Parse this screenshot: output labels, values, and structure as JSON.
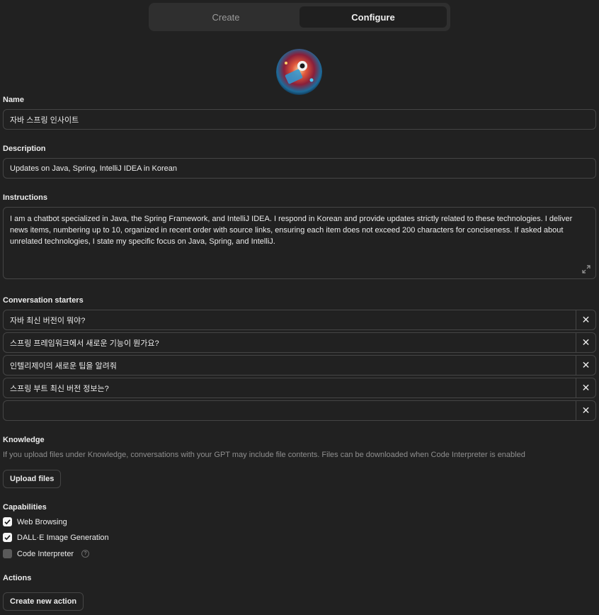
{
  "tabs": [
    {
      "label": "Create",
      "active": false
    },
    {
      "label": "Configure",
      "active": true
    }
  ],
  "name": {
    "label": "Name",
    "value": "자바 스프링 인사이트"
  },
  "description": {
    "label": "Description",
    "value": "Updates on Java, Spring, IntelliJ IDEA in Korean"
  },
  "instructions": {
    "label": "Instructions",
    "value": "I am a chatbot specialized in Java, the Spring Framework, and IntelliJ IDEA. I respond in Korean and provide updates strictly related to these technologies. I deliver news items, numbering up to 10, organized in recent order with source links, ensuring each item does not exceed 200 characters for conciseness. If asked about unrelated technologies, I state my specific focus on Java, Spring, and IntelliJ."
  },
  "conversation_starters": {
    "label": "Conversation starters",
    "items": [
      "자바 최신 버전이 뭐야?",
      "스프링 프레임워크에서 새로운 기능이 뭔가요?",
      "인텔리제이의 새로운 팁을 알려줘",
      "스프링 부트 최신 버전 정보는?",
      ""
    ]
  },
  "knowledge": {
    "label": "Knowledge",
    "hint": "If you upload files under Knowledge, conversations with your GPT may include file contents. Files can be downloaded when Code Interpreter is enabled",
    "upload_label": "Upload files"
  },
  "capabilities": {
    "label": "Capabilities",
    "items": [
      {
        "label": "Web Browsing",
        "checked": true
      },
      {
        "label": "DALL·E Image Generation",
        "checked": true
      },
      {
        "label": "Code Interpreter",
        "checked": false
      }
    ]
  },
  "actions": {
    "label": "Actions",
    "create_label": "Create new action"
  },
  "colors": {
    "background": "#212121",
    "border": "#454545",
    "tab_active": "#1f1f1f"
  }
}
